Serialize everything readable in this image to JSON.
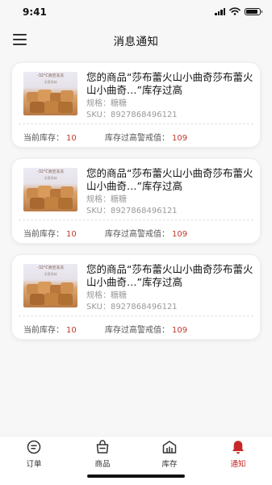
{
  "status_bar": {
    "time": "9:41",
    "battery_level": 0.85
  },
  "header": {
    "title": "消息通知",
    "menu_icon": "menu-icon"
  },
  "notifications": [
    {
      "thumb_title": "-32°C真空冻冻",
      "thumb_sub": "无损风味",
      "product_text": "您的商品“莎布蕾火山小曲奇莎布蕾火山小曲奇…”库存过高",
      "spec": "规格：糖糖",
      "sku": "SKU：8927868496121",
      "current_stock_label": "当前库存：",
      "current_stock_value": "10",
      "threshold_label": "库存过高警戒值：",
      "threshold_value": "109"
    },
    {
      "thumb_title": "-32°C真空冻冻",
      "thumb_sub": "无损风味",
      "product_text": "您的商品“莎布蕾火山小曲奇莎布蕾火山小曲奇…”库存过高",
      "spec": "规格：糖糖",
      "sku": "SKU：8927868496121",
      "current_stock_label": "当前库存：",
      "current_stock_value": "10",
      "threshold_label": "库存过高警戒值：",
      "threshold_value": "109"
    },
    {
      "thumb_title": "-32°C真空冻冻",
      "thumb_sub": "无损风味",
      "product_text": "您的商品“莎布蕾火山小曲奇莎布蕾火山小曲奇…”库存过高",
      "spec": "规格：糖糖",
      "sku": "SKU：8927868496121",
      "current_stock_label": "当前库存：",
      "current_stock_value": "10",
      "threshold_label": "库存过高警戒值：",
      "threshold_value": "109"
    }
  ],
  "tab_bar": {
    "active_index": 3,
    "accent_color": "#c62828",
    "tabs": [
      {
        "label": "订单",
        "icon": "order-icon"
      },
      {
        "label": "商品",
        "icon": "product-bag-icon"
      },
      {
        "label": "库存",
        "icon": "inventory-icon"
      },
      {
        "label": "通知",
        "icon": "bell-icon"
      }
    ]
  }
}
